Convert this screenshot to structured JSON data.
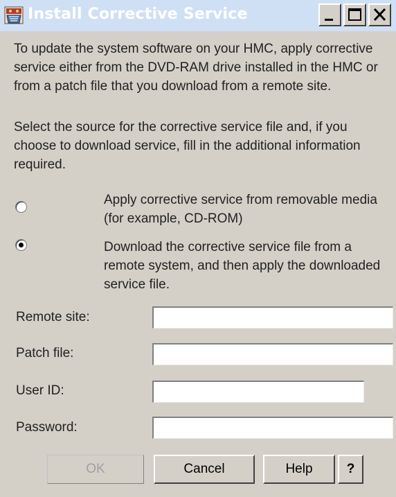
{
  "window": {
    "title": "Install Corrective Service",
    "controls": {
      "minimize": "minimize-icon",
      "maximize": "maximize-icon",
      "close": "close-icon"
    }
  },
  "intro": {
    "paragraph1": "To update the system software on your HMC, apply corrective service either from the DVD-RAM drive installed in the HMC or from a patch file that you download from a remote site.",
    "paragraph2": "Select the source for the corrective service file and, if you choose to download service, fill in the additional information required."
  },
  "options": [
    {
      "label": "Apply corrective service from removable media (for example, CD-ROM)",
      "selected": false
    },
    {
      "label": "Download the corrective service file from a remote system, and then apply the downloaded service file.",
      "selected": true
    }
  ],
  "form": {
    "remote_site": {
      "label": "Remote site:",
      "value": ""
    },
    "patch_file": {
      "label": "Patch file:",
      "value": ""
    },
    "user_id": {
      "label": "User ID:",
      "value": ""
    },
    "password": {
      "label": "Password:",
      "value": ""
    }
  },
  "buttons": {
    "ok": "OK",
    "cancel": "Cancel",
    "help": "Help",
    "question": "?"
  },
  "colors": {
    "titlebar_bg": "#cfe0f5",
    "window_bg": "#d4d0c8",
    "disabled_text": "#a0a0a0"
  }
}
